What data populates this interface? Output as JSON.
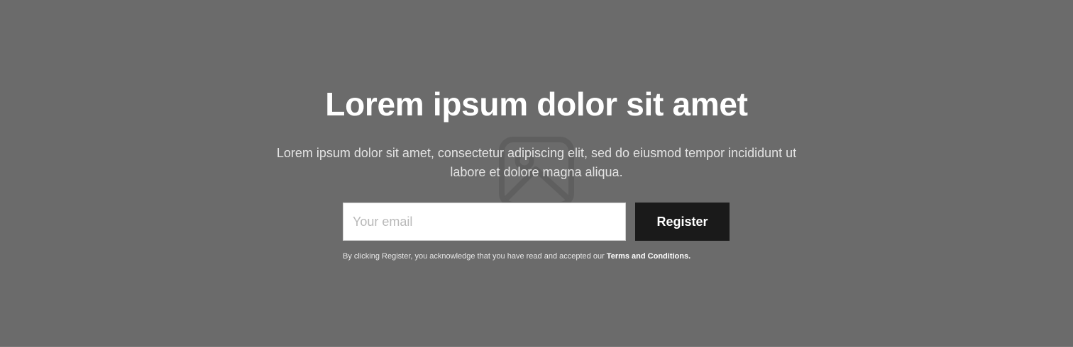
{
  "hero": {
    "title": "Lorem ipsum dolor sit amet",
    "subtitle": "Lorem ipsum dolor sit amet, consectetur adipiscing elit, sed do eiusmod tempor incididunt ut labore et dolore magna aliqua.",
    "background_color": "#6b6b6b",
    "background_icon": "image-placeholder-icon"
  },
  "form": {
    "email_placeholder": "Your email",
    "email_value": "",
    "register_label": "Register",
    "register_button_color": "#1a1a1a"
  },
  "disclaimer": {
    "text": "By clicking Register, you acknowledge that you have read and accepted our ",
    "link_label": "Terms and Conditions."
  }
}
